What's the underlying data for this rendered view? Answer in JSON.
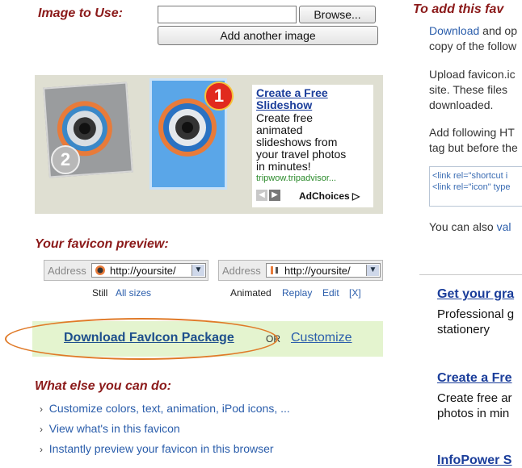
{
  "upload": {
    "image_to_use_label": "Image to Use:",
    "file_value": "",
    "browse_label": "Browse...",
    "add_image_label": "Add another image"
  },
  "ad": {
    "badge_1": "1",
    "badge_2": "2",
    "title_line1": "Create a Free",
    "title_line2": "Slideshow",
    "body_lines": [
      "Create free",
      "animated",
      "slideshows from",
      "your travel photos",
      "in minutes!"
    ],
    "url": "tripwow.tripadvisor...",
    "adchoices": "AdChoices"
  },
  "preview": {
    "heading": "Your favicon preview:",
    "address_label": "Address",
    "url": "http://yoursite/",
    "still_label": "Still",
    "all_sizes": "All sizes",
    "animated_label": "Animated",
    "replay": "Replay",
    "edit": "Edit",
    "close_x": "[X]"
  },
  "download": {
    "package_link": "Download FavIcon Package",
    "or_text": "OR",
    "customize": "Customize"
  },
  "what_else": {
    "heading": "What else you can do:",
    "items": [
      "Customize colors, text, animation, iPod icons, ...",
      "View what's in this favicon",
      "Instantly preview your favicon in this browser"
    ]
  },
  "right": {
    "heading": "To add this fav",
    "p1_link": "Download",
    "p1_rest": " and op",
    "p1_line2": "copy of the follow",
    "p2_line1": "Upload favicon.ic",
    "p2_line2": "site. These files",
    "p2_line3": "downloaded.",
    "p3_line1": "Add following HT",
    "p3_line2": "tag but before the",
    "code_line1": "<link rel=\"shortcut i",
    "code_line2": "<link rel=\"icon\" type",
    "validate_pre": "You can also ",
    "validate_link": "val",
    "ad1_title": "Get your gra",
    "ad1_line1": "Professional g",
    "ad1_line2": "stationery",
    "ad2_title": "Create a Fre",
    "ad2_line1": "Create free ar",
    "ad2_line2": "photos in min",
    "ad3_title": "InfoPower S"
  },
  "colors": {
    "heading_red": "#8b1a1a",
    "link_blue": "#2a5dab",
    "download_bar_green": "#e4f4cf",
    "highlight_oval_orange": "#e07a28"
  }
}
